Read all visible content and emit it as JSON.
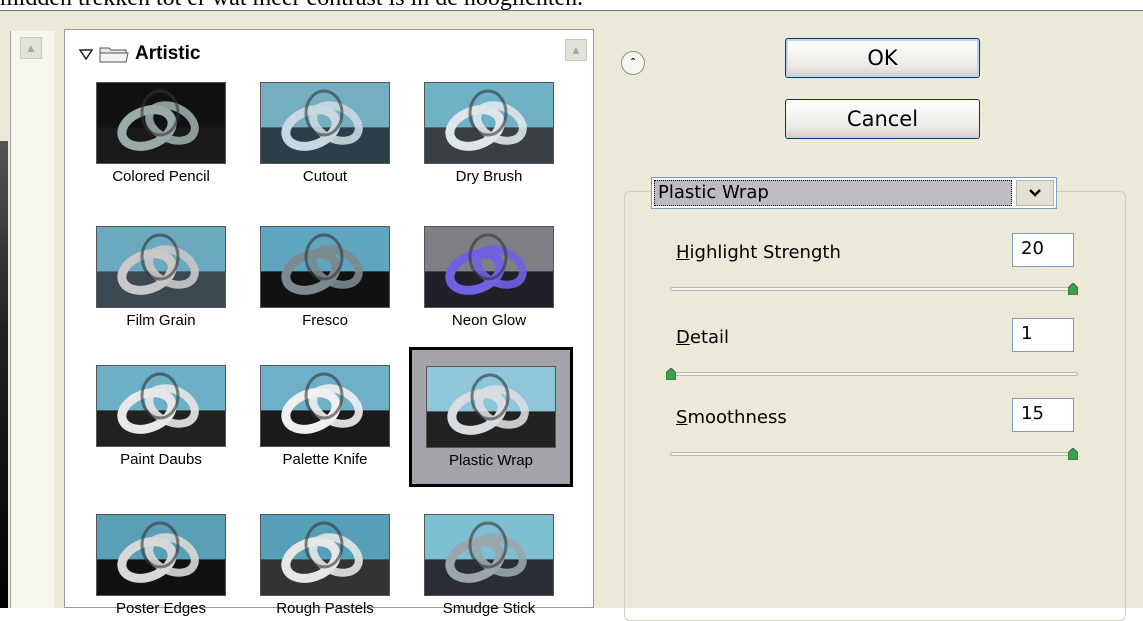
{
  "caption": "midden trekken tot er wat meer contrast is in de hooglichten.",
  "gallery": {
    "category": "Artistic",
    "filters": [
      {
        "label": "Colored Pencil",
        "key": "colored-pencil",
        "selected": false
      },
      {
        "label": "Cutout",
        "key": "cutout",
        "selected": false
      },
      {
        "label": "Dry Brush",
        "key": "dry-brush",
        "selected": false
      },
      {
        "label": "Film Grain",
        "key": "film-grain",
        "selected": false
      },
      {
        "label": "Fresco",
        "key": "fresco",
        "selected": false
      },
      {
        "label": "Neon Glow",
        "key": "neon-glow",
        "selected": false
      },
      {
        "label": "Paint Daubs",
        "key": "paint-daubs",
        "selected": false
      },
      {
        "label": "Palette Knife",
        "key": "palette-knife",
        "selected": false
      },
      {
        "label": "Plastic Wrap",
        "key": "plastic-wrap",
        "selected": true
      },
      {
        "label": "Poster Edges",
        "key": "poster-edges",
        "selected": false
      },
      {
        "label": "Rough Pastels",
        "key": "rough-pastels",
        "selected": false
      },
      {
        "label": "Smudge Stick",
        "key": "smudge-stick",
        "selected": false
      }
    ]
  },
  "buttons": {
    "ok": "OK",
    "cancel": "Cancel"
  },
  "filter_select": {
    "value": "Plastic Wrap"
  },
  "params": [
    {
      "label_mnemonic": "H",
      "label_rest": "ighlight Strength",
      "value": "20",
      "level": 1.0
    },
    {
      "label_mnemonic": "D",
      "label_rest": "etail",
      "value": "1",
      "level": 0.0
    },
    {
      "label_mnemonic": "S",
      "label_rest": "moothness",
      "value": "15",
      "level": 1.0
    }
  ],
  "icons": {
    "collapse": "double-chevron-up-icon",
    "category_toggle": "triangle-down-icon",
    "category_folder": "folder-icon",
    "dropdown": "chevron-down-icon"
  },
  "colors": {
    "dialog_bg": "#ece9d8",
    "selected_thumb_bg": "#a4a3a9",
    "button_border": "#003c74",
    "slider_thumb": "#3aa04a"
  }
}
